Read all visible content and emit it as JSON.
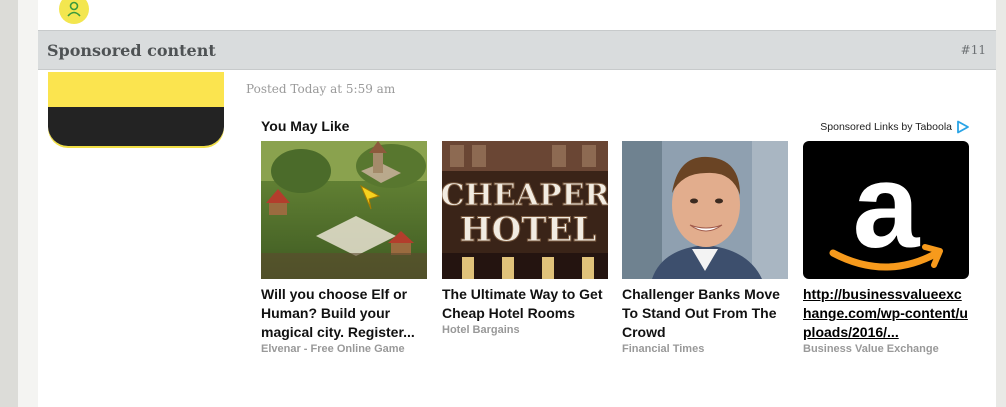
{
  "post": {
    "header_title": "Sponsored content",
    "post_number": "#11",
    "posted_time": "Posted Today at 5:59 am"
  },
  "widget": {
    "heading": "You May Like",
    "sponsored_label": "Sponsored Links by Taboola",
    "taboola_icon": "play-triangle-icon",
    "cards": [
      {
        "title": "Will you choose Elf or Human? Build your magical city. Register...",
        "source": "Elvenar - Free Online Game",
        "image": "fantasy-city-game-image"
      },
      {
        "title": "The Ultimate Way to Get Cheap Hotel Rooms",
        "source": "Hotel Bargains",
        "image": "cheaper-hotel-sign-image",
        "image_text_1": "CHEAPER",
        "image_text_2": "HOTEL"
      },
      {
        "title": "Challenger Banks Move To Stand Out From The Crowd",
        "source": "Financial Times",
        "image": "man-portrait-image"
      },
      {
        "title": "http://businessvalueexchange.com/wp-content/uploads/2016/...",
        "source": "Business Value Exchange",
        "image": "amazon-logo-image",
        "image_text": "a"
      }
    ]
  },
  "colors": {
    "header_bg": "#d9dcdd",
    "avatar_yellow": "#fbe44f",
    "taboola_blue": "#2aa4e6"
  }
}
